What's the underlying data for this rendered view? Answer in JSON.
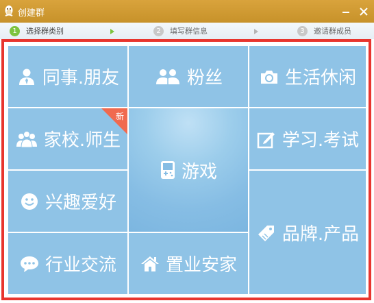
{
  "window": {
    "title": "创建群"
  },
  "steps": [
    {
      "num": "1",
      "label": "选择群类别",
      "state": "active"
    },
    {
      "num": "2",
      "label": "填写群信息",
      "state": "inactive"
    },
    {
      "num": "3",
      "label": "邀请群成员",
      "state": "inactive"
    }
  ],
  "categories": [
    {
      "label": "同事.朋友",
      "icon": "person-tie-icon"
    },
    {
      "label": "粉丝",
      "icon": "two-people-icon"
    },
    {
      "label": "生活休闲",
      "icon": "camera-icon"
    },
    {
      "label": "家校.师生",
      "icon": "group-people-icon",
      "badge": "新"
    },
    {
      "label": "游戏",
      "icon": "gamepad-icon"
    },
    {
      "label": "学习.考试",
      "icon": "edit-note-icon"
    },
    {
      "label": "兴趣爱好",
      "icon": "smiley-icon"
    },
    {
      "label": "品牌.产品",
      "icon": "price-tag-icon"
    },
    {
      "label": "行业交流",
      "icon": "chat-bubble-icon"
    },
    {
      "label": "置业安家",
      "icon": "house-icon"
    }
  ],
  "colors": {
    "titlebar": "#c99530",
    "tile": "#8fc3e6",
    "frame_border": "#e8352e",
    "step_active": "#7dc33e",
    "step_inactive": "#c8c8c8",
    "badge": "#f06a4f"
  }
}
